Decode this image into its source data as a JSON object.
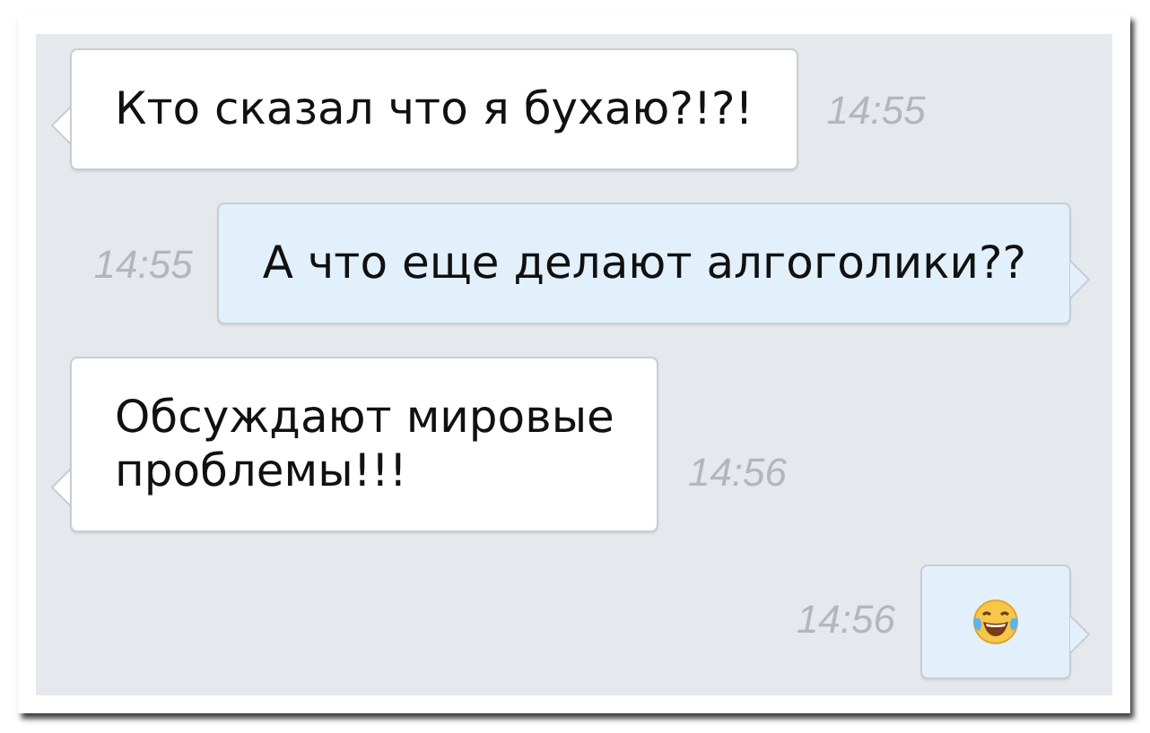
{
  "messages": [
    {
      "outgoing": false,
      "kind": "text",
      "text": "Кто сказал что я бухаю?!?!",
      "time": "14:55"
    },
    {
      "outgoing": true,
      "kind": "text",
      "text": "А что еще делают алгоголики??",
      "time": "14:55"
    },
    {
      "outgoing": false,
      "kind": "text",
      "text": "Обсуждают мировые\nпроблемы!!!",
      "time": "14:56"
    },
    {
      "outgoing": true,
      "kind": "emoji",
      "time": "14:56"
    }
  ]
}
